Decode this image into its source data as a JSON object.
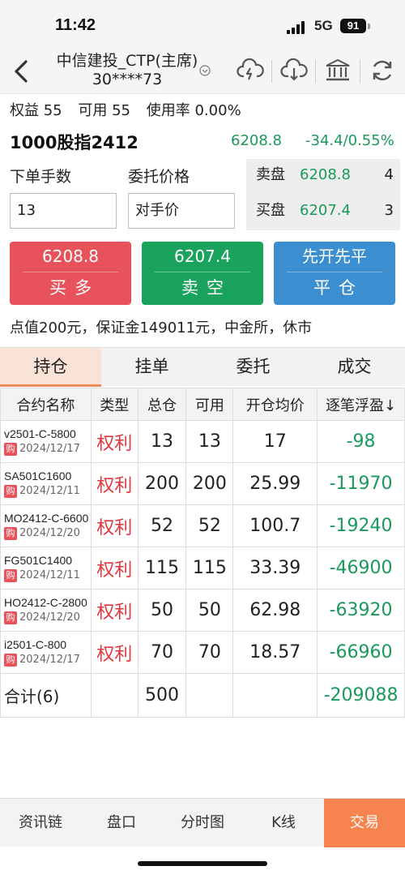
{
  "status": {
    "time": "11:42",
    "network": "5G",
    "battery": "91"
  },
  "nav": {
    "title": "中信建投_CTP(主席)",
    "account": "30****73"
  },
  "account": {
    "equity_label": "权益",
    "equity": "55",
    "avail_label": "可用",
    "avail": "55",
    "usage_label": "使用率",
    "usage": "0.00%"
  },
  "contract": {
    "name": "1000股指2412",
    "last": "6208.8",
    "change": "-34.4/0.55%"
  },
  "order": {
    "qty_label": "下单手数",
    "qty": "13",
    "price_label": "委托价格",
    "price": "对手价"
  },
  "book": {
    "ask_label": "卖盘",
    "ask_price": "6208.8",
    "ask_vol": "4",
    "bid_label": "买盘",
    "bid_price": "6207.4",
    "bid_vol": "3"
  },
  "buttons": {
    "buy_price": "6208.8",
    "buy_label": "买多",
    "sell_price": "6207.4",
    "sell_label": "卖空",
    "first_label": "先开先平",
    "close_label": "平仓"
  },
  "info": "点值200元，保证金149011元，中金所，休市",
  "tabs": [
    "持仓",
    "挂单",
    "委托",
    "成交"
  ],
  "table": {
    "headers": [
      "合约名称",
      "类型",
      "总仓",
      "可用",
      "开仓均价",
      "逐笔浮盈↓"
    ],
    "rows": [
      {
        "code": "v2501-C-5800",
        "tag": "购",
        "date": "2024/12/17",
        "type": "权利",
        "total": "13",
        "avail": "13",
        "avg": "17",
        "pnl": "-98"
      },
      {
        "code": "SA501C1600",
        "tag": "购",
        "date": "2024/12/11",
        "type": "权利",
        "total": "200",
        "avail": "200",
        "avg": "25.99",
        "pnl": "-11970"
      },
      {
        "code": "MO2412-C-6600",
        "tag": "购",
        "date": "2024/12/20",
        "type": "权利",
        "total": "52",
        "avail": "52",
        "avg": "100.7",
        "pnl": "-19240"
      },
      {
        "code": "FG501C1400",
        "tag": "购",
        "date": "2024/12/11",
        "type": "权利",
        "total": "115",
        "avail": "115",
        "avg": "33.39",
        "pnl": "-46900"
      },
      {
        "code": "HO2412-C-2800",
        "tag": "购",
        "date": "2024/12/20",
        "type": "权利",
        "total": "50",
        "avail": "50",
        "avg": "62.98",
        "pnl": "-63920"
      },
      {
        "code": "i2501-C-800",
        "tag": "购",
        "date": "2024/12/17",
        "type": "权利",
        "total": "70",
        "avail": "70",
        "avg": "18.57",
        "pnl": "-66960"
      }
    ],
    "total": {
      "label": "合计(6)",
      "total": "500",
      "pnl": "-209088"
    }
  },
  "bottom_nav": [
    "资讯链",
    "盘口",
    "分时图",
    "K线",
    "交易"
  ],
  "icons": [
    "back-arrow-icon",
    "cloud-upload-icon",
    "cloud-download-icon",
    "bank-icon",
    "refresh-icon"
  ],
  "colors": {
    "green": "#1a9a5a",
    "red": "#e8525a",
    "blue": "#3b8fd1",
    "accent": "#f7844e"
  }
}
